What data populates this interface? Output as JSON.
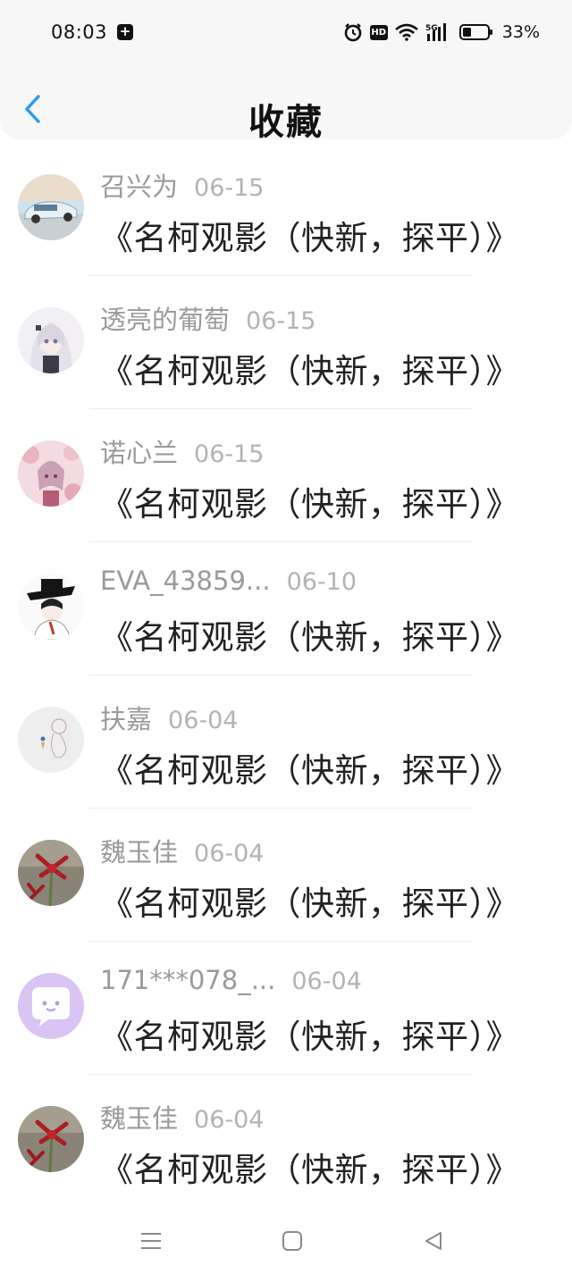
{
  "status_bar": {
    "time": "08:03",
    "notification_icon": "plus-square-icon",
    "hd_label": "HD",
    "network": "5G",
    "battery_percent": "33%"
  },
  "header": {
    "title": "收藏",
    "back_icon": "chevron-left-icon",
    "accent_color": "#2a9bf0"
  },
  "favorites": [
    {
      "user": "召兴为",
      "date": "06-15",
      "title": "《名柯观影（快新，探平）》",
      "avatar": "car-photo"
    },
    {
      "user": "透亮的葡萄",
      "date": "06-15",
      "title": "《名柯观影（快新，探平）》",
      "avatar": "anime-girl-white-hair"
    },
    {
      "user": "诺心兰",
      "date": "06-15",
      "title": "《名柯观影（快新，探平）》",
      "avatar": "anime-girl-pink"
    },
    {
      "user": "EVA_43859...",
      "date": "06-10",
      "title": "《名柯观影（快新，探平）》",
      "avatar": "anime-boy-hat"
    },
    {
      "user": "扶嘉",
      "date": "06-04",
      "title": "《名柯观影（快新，探平）》",
      "avatar": "sketch-figure"
    },
    {
      "user": "魏玉佳",
      "date": "06-04",
      "title": "《名柯观影（快新，探平）》",
      "avatar": "red-flowers"
    },
    {
      "user": "171***078_...",
      "date": "06-04",
      "title": "《名柯观影（快新，探平）》",
      "avatar": "chat-bubble-default"
    },
    {
      "user": "魏玉佳",
      "date": "06-04",
      "title": "《名柯观影（快新，探平）》",
      "avatar": "red-flowers"
    }
  ],
  "system_nav": {
    "menu_icon": "menu-icon",
    "home_icon": "home-square-icon",
    "back_icon": "back-triangle-icon"
  }
}
